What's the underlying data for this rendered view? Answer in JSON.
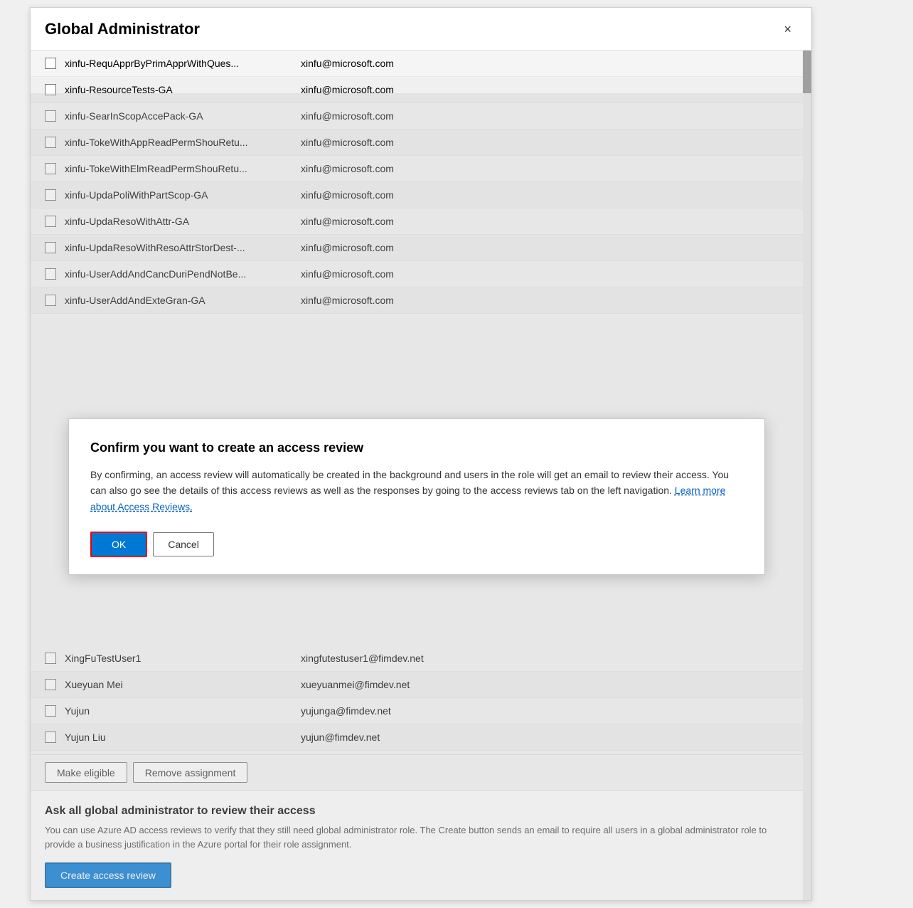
{
  "panel": {
    "title": "Global Administrator",
    "close_label": "×"
  },
  "top_list_items": [
    {
      "name": "xinfu-RequApprByPrimApprWithQues...",
      "email": "xinfu@microsoft.com"
    },
    {
      "name": "xinfu-ResourceTests-GA",
      "email": "xinfu@microsoft.com"
    },
    {
      "name": "xinfu-SearInScopAccePack-GA",
      "email": "xinfu@microsoft.com"
    },
    {
      "name": "xinfu-TokeWithAppReadPermShouRetu...",
      "email": "xinfu@microsoft.com"
    },
    {
      "name": "xinfu-TokeWithElmReadPermShouRetu...",
      "email": "xinfu@microsoft.com"
    },
    {
      "name": "xinfu-UpdaPoliWithPartScop-GA",
      "email": "xinfu@microsoft.com"
    },
    {
      "name": "xinfu-UpdaResoWithAttr-GA",
      "email": "xinfu@microsoft.com"
    },
    {
      "name": "xinfu-UpdaResoWithResoAttrStorDest-...",
      "email": "xinfu@microsoft.com"
    },
    {
      "name": "xinfu-UserAddAndCancDuriPendNotBe...",
      "email": "xinfu@microsoft.com"
    },
    {
      "name": "xinfu-UserAddAndExteGran-GA",
      "email": "xinfu@microsoft.com"
    }
  ],
  "bottom_list_items": [
    {
      "name": "XingFuTestUser1",
      "email": "xingfutestuser1@fimdev.net"
    },
    {
      "name": "Xueyuan Mei",
      "email": "xueyuanmei@fimdev.net"
    },
    {
      "name": "Yujun",
      "email": "yujunga@fimdev.net"
    },
    {
      "name": "Yujun Liu",
      "email": "yujun@fimdev.net"
    }
  ],
  "action_buttons": {
    "make_eligible": "Make eligible",
    "remove_assignment": "Remove assignment"
  },
  "bottom_section": {
    "title": "Ask all global administrator to review their access",
    "description": "You can use Azure AD access reviews to verify that they still need global administrator role. The Create button sends an email to require all users in a global administrator role to provide a business justification in the Azure portal for their role assignment.",
    "create_button": "Create access review"
  },
  "dialog": {
    "title": "Confirm you want to create an access review",
    "body_text": "By confirming, an access review will automatically be created in the background and users in the role will get an email to review their access. You can also go see the details of this access reviews as well as the responses by going to the access reviews tab on the left navigation.",
    "link_text": "Learn more about Access Reviews.",
    "ok_label": "OK",
    "cancel_label": "Cancel"
  }
}
